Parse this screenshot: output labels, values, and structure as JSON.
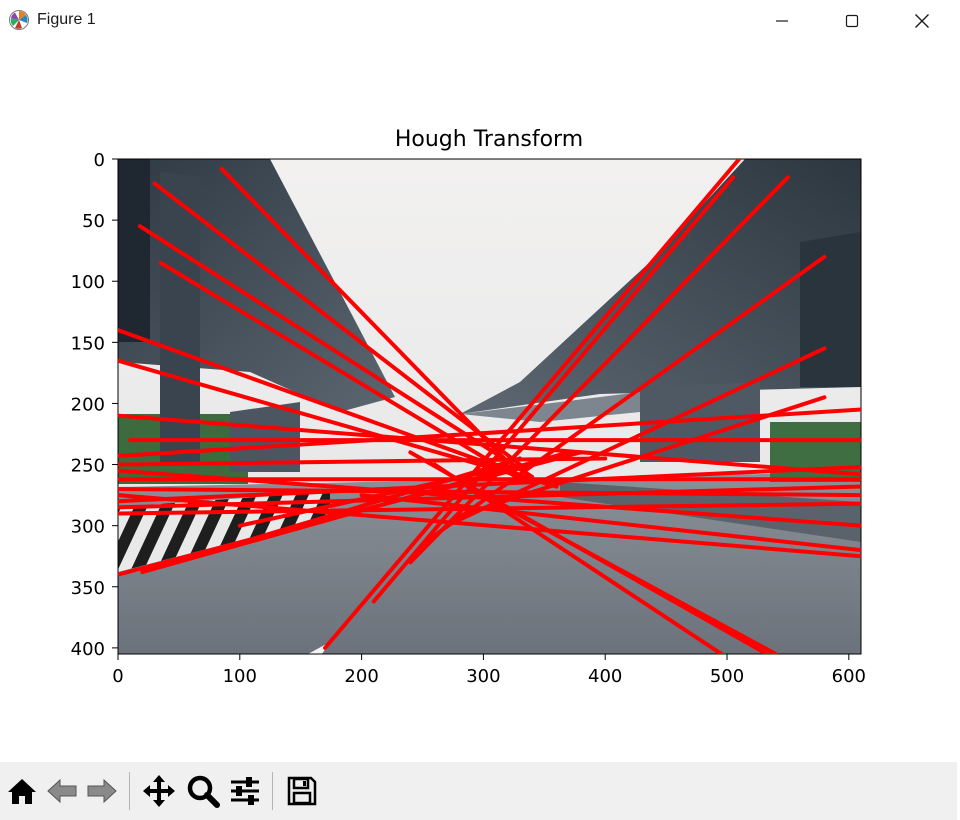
{
  "window": {
    "title": "Figure 1",
    "icon": "matplotlib-logo-icon",
    "controls": [
      "minimize-icon",
      "maximize-icon",
      "close-icon"
    ]
  },
  "chart_data": {
    "type": "image",
    "title": "Hough Transform",
    "xlabel": "",
    "ylabel": "",
    "xlim": [
      0,
      610
    ],
    "ylim": [
      405,
      0
    ],
    "xticks": [
      0,
      100,
      200,
      300,
      400,
      500,
      600
    ],
    "yticks": [
      0,
      50,
      100,
      150,
      200,
      250,
      300,
      350,
      400
    ],
    "line_color": "#ff0000",
    "detected_lines": [
      [
        85,
        8,
        320,
        248
      ],
      [
        30,
        20,
        330,
        250
      ],
      [
        18,
        55,
        340,
        260
      ],
      [
        35,
        85,
        330,
        262
      ],
      [
        0,
        140,
        340,
        262
      ],
      [
        0,
        165,
        360,
        268
      ],
      [
        170,
        400,
        510,
        0
      ],
      [
        210,
        362,
        505,
        15
      ],
      [
        240,
        330,
        550,
        15
      ],
      [
        250,
        315,
        580,
        80
      ],
      [
        270,
        300,
        580,
        155
      ],
      [
        280,
        292,
        580,
        195
      ],
      [
        240,
        240,
        538,
        408
      ],
      [
        260,
        250,
        500,
        408
      ],
      [
        290,
        270,
        540,
        405
      ],
      [
        0,
        210,
        610,
        258
      ],
      [
        0,
        243,
        610,
        205
      ],
      [
        10,
        230,
        610,
        230
      ],
      [
        0,
        262,
        610,
        262
      ],
      [
        0,
        270,
        610,
        275
      ],
      [
        0,
        280,
        610,
        252
      ],
      [
        0,
        285,
        610,
        268
      ],
      [
        0,
        290,
        610,
        282
      ],
      [
        0,
        275,
        610,
        325
      ],
      [
        0,
        255,
        610,
        300
      ],
      [
        0,
        340,
        380,
        240
      ],
      [
        20,
        338,
        370,
        240
      ],
      [
        80,
        320,
        330,
        245
      ],
      [
        100,
        300,
        330,
        250
      ],
      [
        0,
        250,
        400,
        245
      ],
      [
        200,
        275,
        610,
        320
      ]
    ],
    "background_image": "highway-overpass-photo"
  },
  "toolbar": {
    "buttons": [
      "home-icon",
      "back-icon",
      "forward-icon",
      "pan-icon",
      "zoom-icon",
      "configure-subplots-icon",
      "save-icon"
    ],
    "colors": {
      "bg": "#f0f0f0",
      "icon": "#000000",
      "disabled": "#7f7f7f"
    }
  }
}
